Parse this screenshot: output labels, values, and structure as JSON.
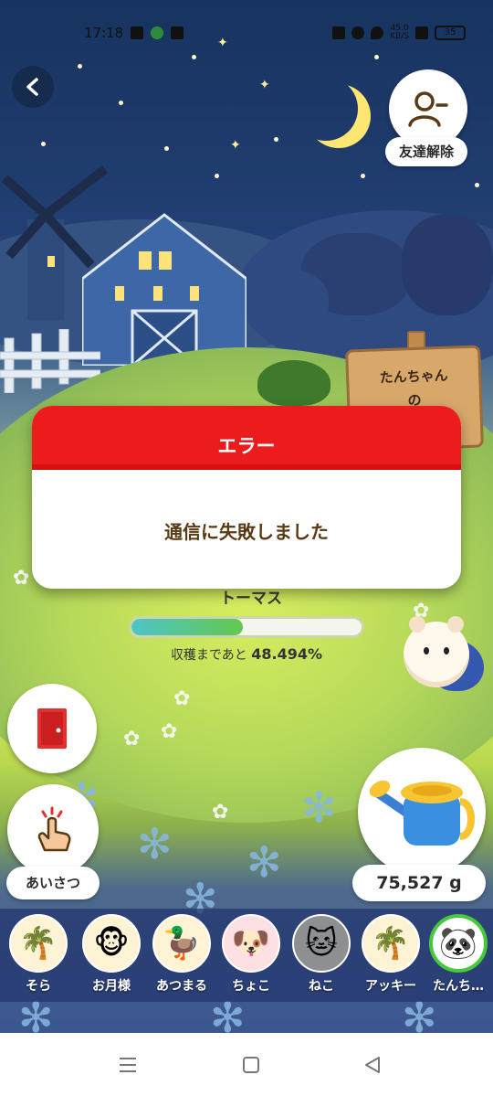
{
  "status_bar": {
    "time": "17:18",
    "network_speed_value": "45.0",
    "network_speed_unit": "KB/S",
    "battery": "35"
  },
  "header": {
    "back_icon": "back-arrow-icon",
    "friend_remove_label": "友達解除",
    "friend_remove_icon": "user-minus-icon"
  },
  "signboard": {
    "line1": "たんちゃん",
    "line2": "の"
  },
  "dialog": {
    "title": "エラー",
    "message": "通信に失敗しました"
  },
  "crop": {
    "name": "トーマス",
    "progress_label": "収穫まであと",
    "progress_value": "48.494%",
    "progress_fraction": 0.48494
  },
  "actions": {
    "exit_icon": "door-exit-icon",
    "greet_icon": "tap-hand-icon",
    "greet_label": "あいさつ",
    "water_icon": "watering-can-icon",
    "water_amount": "75,527 g"
  },
  "friends": [
    {
      "name": "そら",
      "avatar": "palm-tree-icon"
    },
    {
      "name": "お月様",
      "avatar": "monkey-icon"
    },
    {
      "name": "あつまる",
      "avatar": "duck-icon"
    },
    {
      "name": "ちょこ",
      "avatar": "dog-icon"
    },
    {
      "name": "ねこ",
      "avatar": "cat-photo-icon"
    },
    {
      "name": "アッキー",
      "avatar": "palm-tree-icon"
    },
    {
      "name": "たんち…",
      "avatar": "panda-icon",
      "selected": true
    }
  ],
  "navigation": {
    "menu_icon": "recents-icon",
    "home_icon": "home-icon",
    "back_icon": "nav-back-icon"
  },
  "colors": {
    "error_red": "#ec1c1c",
    "progress_green": "#64c84e",
    "selected_friend": "#46c93a"
  }
}
